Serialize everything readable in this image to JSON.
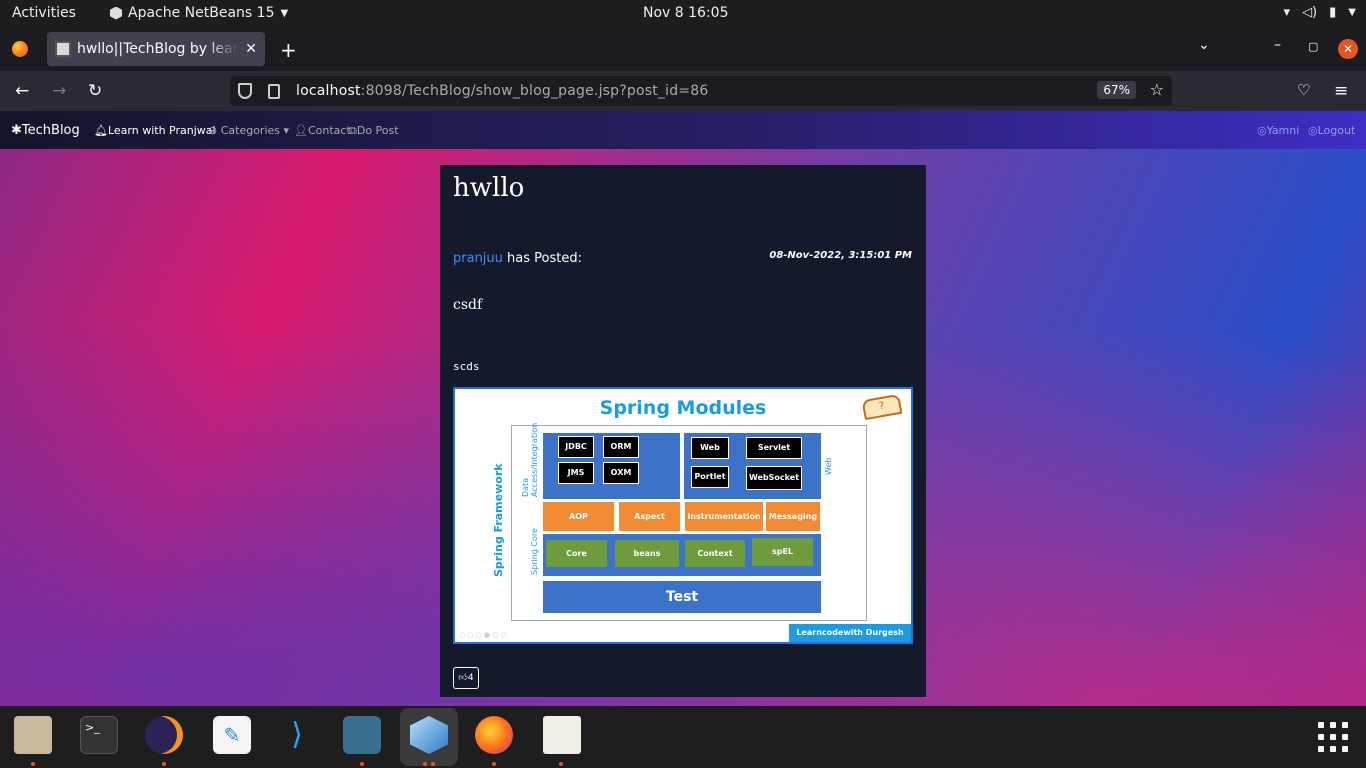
{
  "system": {
    "activities": "Activities",
    "app_name": "Apache NetBeans 15",
    "clock": "Nov 8  16:05"
  },
  "browser": {
    "tab_title": "hwllo||TechBlog by learn",
    "url_host": "localhost",
    "url_path": ":8098/TechBlog/show_blog_page.jsp?post_id=86",
    "zoom": "67%"
  },
  "site_nav": {
    "brand": "TechBlog",
    "items": [
      "Learn with Pranjwal",
      "Categories",
      "Contact",
      "Do Post"
    ],
    "user": "Yamni",
    "logout": "Logout"
  },
  "post": {
    "title": "hwllo",
    "author": "pranjuu",
    "posted_text": "has Posted:",
    "date": "08-Nov-2022, 3:15:01 PM",
    "content": "csdf",
    "code": "scds",
    "like_count": "4"
  },
  "post_image": {
    "title": "Spring Modules",
    "framework_label": "Spring Framework",
    "data_label": "Data Access/Integration",
    "web_label": "Web",
    "core_label": "Spring Core",
    "data_modules": [
      "JDBC",
      "ORM",
      "JMS",
      "OXM"
    ],
    "web_modules": [
      "Web",
      "Servlet",
      "Portlet",
      "WebSocket"
    ],
    "middle_modules": [
      "AOP",
      "Aspect",
      "Instrumentation",
      "Messaging"
    ],
    "core_modules": [
      "Core",
      "beans",
      "Context",
      "spEL"
    ],
    "test": "Test",
    "brand": "Learncodewith Durgesh"
  },
  "dock": {
    "apps": [
      "files-icon",
      "terminal-icon",
      "eclipse-icon",
      "text-editor-icon",
      "vscode-icon",
      "mysql-workbench-icon",
      "netbeans-icon",
      "firefox-icon",
      "document-viewer-icon"
    ]
  }
}
